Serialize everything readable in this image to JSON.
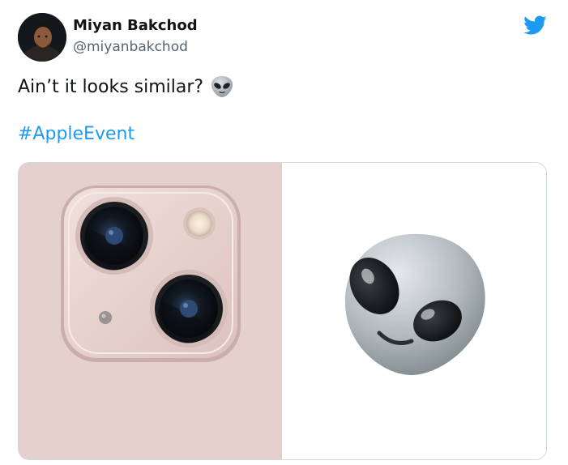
{
  "tweet": {
    "author_name": "Miyan Bakchod",
    "author_handle": "@miyanbakchod",
    "text": "Ain’t it looks similar?",
    "inline_emoji_icon": "alien-emoji-icon",
    "hashtag": "#AppleEvent",
    "media": {
      "left_image": "iphone-13-camera-module-photo",
      "right_image": "alien-emoji-image"
    }
  },
  "colors": {
    "link": "#1d9bf0",
    "twitter_brand": "#1d9bf0",
    "text_primary": "#0f1419",
    "text_secondary": "#536471",
    "border": "#cfd9de",
    "phone_pink": "#e5cfcc"
  },
  "icons": {
    "twitter": "twitter-bird-icon",
    "avatar": "avatar"
  }
}
